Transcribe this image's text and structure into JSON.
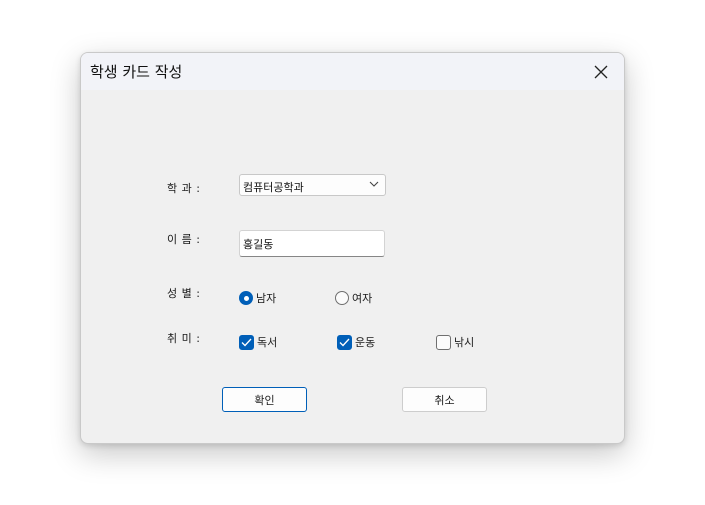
{
  "window": {
    "title": "학생 카드 작성"
  },
  "form": {
    "department": {
      "label": "학 과 :",
      "value": "컴퓨터공학과"
    },
    "name": {
      "label": "이 름 :",
      "value": "홍길동"
    },
    "gender": {
      "label": "성 별 :",
      "options": [
        {
          "label": "남자",
          "checked": true
        },
        {
          "label": "여자",
          "checked": false
        }
      ]
    },
    "hobby": {
      "label": "취 미 :",
      "options": [
        {
          "label": "독서",
          "checked": true
        },
        {
          "label": "운동",
          "checked": true
        },
        {
          "label": "낚시",
          "checked": false
        }
      ]
    }
  },
  "buttons": {
    "ok": "확인",
    "cancel": "취소"
  },
  "colors": {
    "accent": "#005fb8",
    "window_bg": "#f0f0f0",
    "titlebar_bg": "#f2f3f8"
  }
}
